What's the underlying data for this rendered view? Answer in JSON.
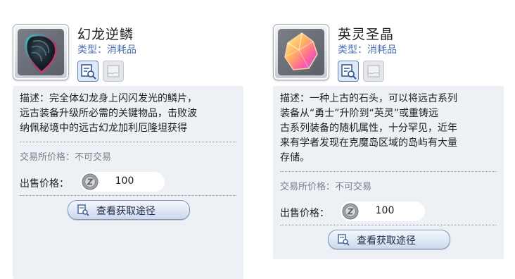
{
  "items": [
    {
      "name": "幻龙逆鳞",
      "type": "类型：消耗品",
      "description": [
        "描述：完全体幻龙身上闪闪发光的鳞片，",
        "远古装备升级所必需的关键物品，击败波",
        "纳佩秘境中的远古幻龙加利厄隆坦获得"
      ],
      "trade_price": "交易所价格：不可交易",
      "sell_label": "出售价格：",
      "sell_value": "100",
      "acquire_label": "查看获取途径",
      "icon": "dragon-scale-icon"
    },
    {
      "name": "英灵圣晶",
      "type": "类型：消耗品",
      "description": [
        "描述：一种上古的石头，可以将远古系列",
        "装备从“勇士”升阶到“英灵”或重铸远",
        "古系列装备的随机属性，十分罕见，近年",
        "来有学者发现在克魔岛区域的岛屿有大量",
        "存储。"
      ],
      "trade_price": "交易所价格：不可交易",
      "sell_label": "出售价格：",
      "sell_value": "100",
      "acquire_label": "查看获取途径",
      "icon": "crystal-icon"
    }
  ]
}
